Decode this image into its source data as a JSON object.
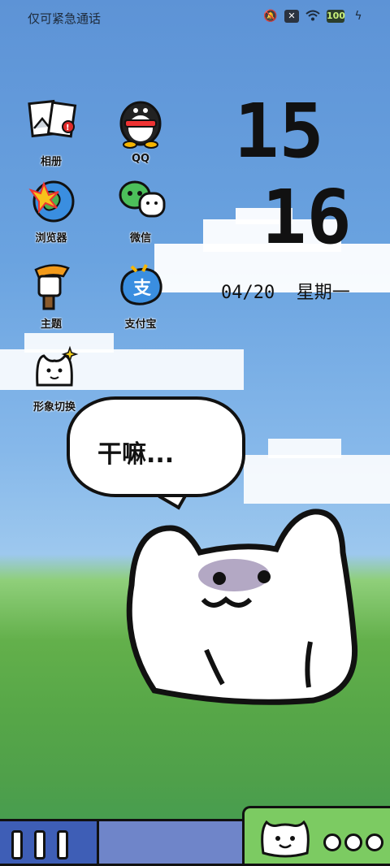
{
  "status_bar": {
    "carrier_text": "仅可紧急通话",
    "icons": [
      "mute-icon",
      "no-sim-icon",
      "wifi-icon",
      "battery-icon",
      "charging-icon"
    ],
    "battery_label": "100"
  },
  "apps": [
    {
      "label": "相册",
      "icon": "gallery-icon"
    },
    {
      "label": "QQ",
      "icon": "qq-penguin-icon"
    },
    {
      "label": "浏览器",
      "icon": "browser-icon"
    },
    {
      "label": "微信",
      "icon": "wechat-icon"
    },
    {
      "label": "主题",
      "icon": "theme-icon"
    },
    {
      "label": "支付宝",
      "icon": "alipay-icon"
    },
    {
      "label": "形象切换",
      "icon": "avatar-switch-icon"
    }
  ],
  "clock": {
    "hour": "15",
    "minute": "16",
    "date": "04/20",
    "weekday": "星期一"
  },
  "speech_bubble": {
    "text": "干嘛..."
  },
  "dock": {
    "left_icon": "recents-bars-icon",
    "center_icon": "cat-face-icon",
    "right_icon": "more-dots-icon"
  },
  "colors": {
    "sky": "#6aa3e0",
    "grass": "#57a748",
    "dock_left": "#3e5eb6",
    "dock_right": "#7ccb62"
  }
}
